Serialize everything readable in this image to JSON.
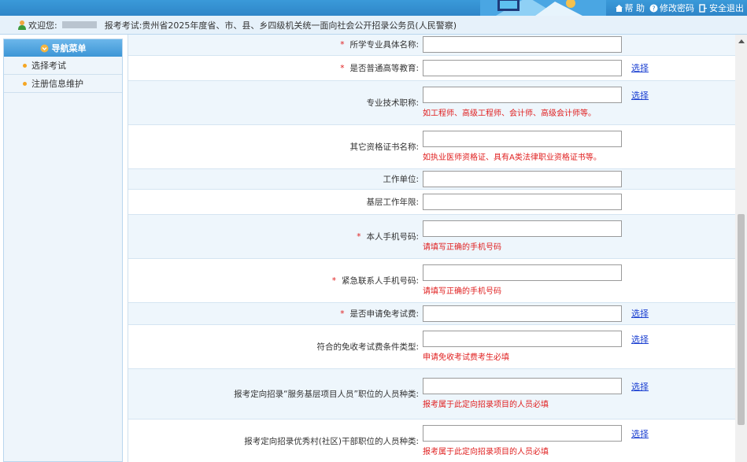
{
  "header": {
    "help_label": "帮 助",
    "change_password_label": "修改密码",
    "logout_label": "安全退出"
  },
  "info": {
    "welcome_label": "欢迎您:",
    "exam_label": "报考考试:贵州省2025年度省、市、县、乡四级机关统一面向社会公开招录公务员(人民警察)"
  },
  "sidebar": {
    "title": "导航菜单",
    "items": [
      {
        "label": "选择考试"
      },
      {
        "label": "注册信息维护"
      }
    ]
  },
  "form": {
    "rows": [
      {
        "label": "所学专业具体名称:",
        "required": true,
        "pick": "",
        "hint": ""
      },
      {
        "label": "是否普通高等教育:",
        "required": true,
        "pick": "选择",
        "hint": ""
      },
      {
        "label": "专业技术职称:",
        "required": false,
        "pick": "选择",
        "hint": "如工程师、高级工程师、会计师、高级会计师等。"
      },
      {
        "label": "其它资格证书名称:",
        "required": false,
        "pick": "",
        "hint": "如执业医师资格证、具有A类法律职业资格证书等。"
      },
      {
        "label": "工作单位:",
        "required": false,
        "pick": "",
        "hint": ""
      },
      {
        "label": "基层工作年限:",
        "required": false,
        "pick": "",
        "hint": ""
      },
      {
        "label": "本人手机号码:",
        "required": true,
        "pick": "",
        "hint": "请填写正确的手机号码"
      },
      {
        "label": "紧急联系人手机号码:",
        "required": true,
        "pick": "",
        "hint": "请填写正确的手机号码"
      },
      {
        "label": "是否申请免考试费:",
        "required": true,
        "pick": "选择",
        "hint": ""
      },
      {
        "label": "符合的免收考试费条件类型:",
        "required": false,
        "pick": "选择",
        "hint": "申请免收考试费考生必填"
      },
      {
        "label": "报考定向招录“服务基层项目人员”职位的人员种类:",
        "required": false,
        "pick": "选择",
        "hint": "报考属于此定向招录项目的人员必填"
      },
      {
        "label": "报考定向招录优秀村(社区)干部职位的人员种类:",
        "required": false,
        "pick": "选择",
        "hint": "报考属于此定向招录项目的人员必填"
      }
    ]
  },
  "colors": {
    "banner": "#2f86c8",
    "required": "#e02020",
    "link": "#1a3fd1",
    "alt_row": "#eef6fc"
  }
}
